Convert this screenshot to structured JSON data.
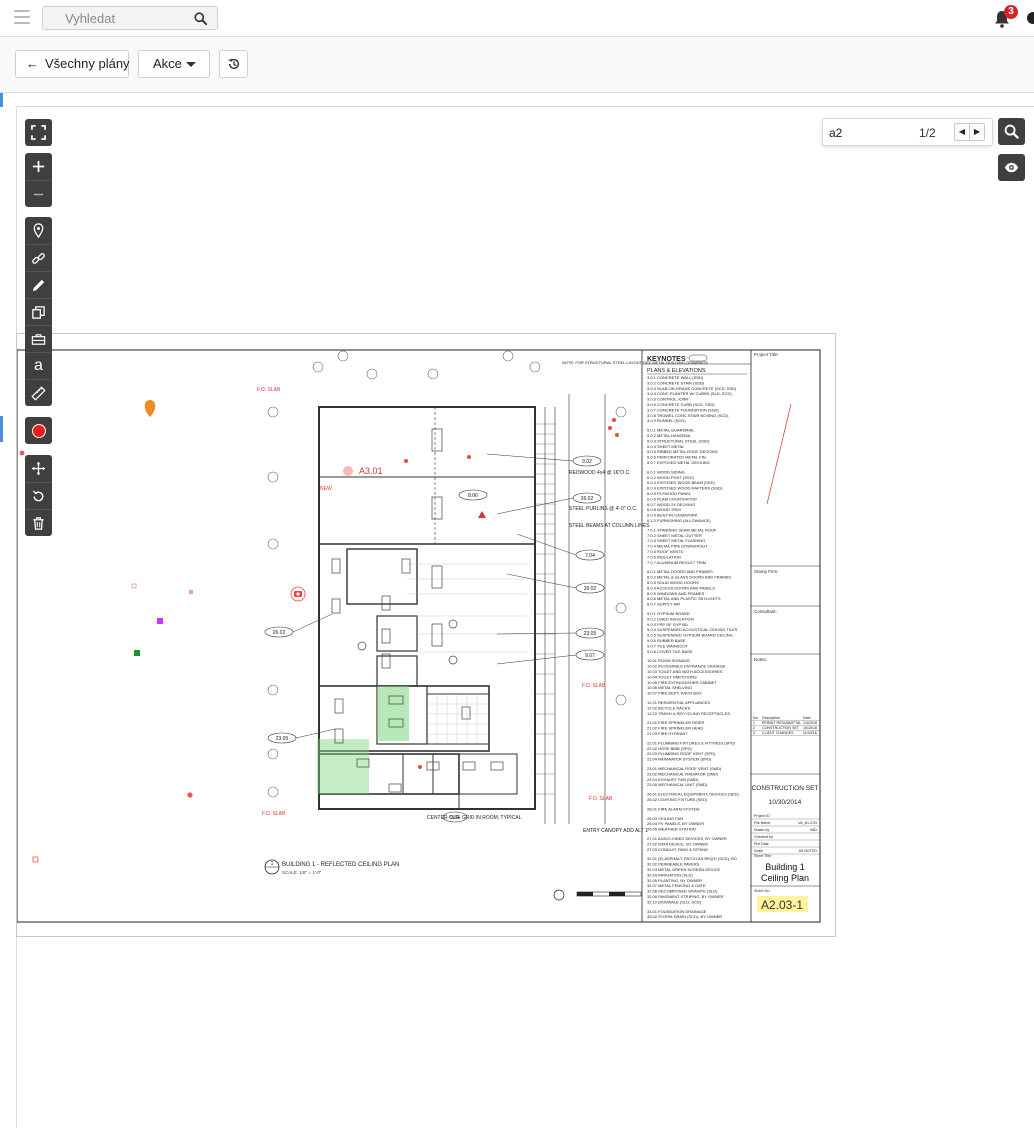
{
  "header": {
    "search": {
      "placeholder": "Vyhledat",
      "value": ""
    },
    "notifications": {
      "count": "3"
    }
  },
  "toolbar": {
    "back_label": "Všechny plány",
    "actions_label": "Akce"
  },
  "find": {
    "query": "a2",
    "count": "1/2"
  },
  "tools": {
    "text_glyph": "a"
  },
  "drawing": {
    "keynotes_title": "KEYNOTES",
    "section_title": "PLANS & ELEVATIONS",
    "project_title_label": "Project Title:",
    "stamp_label": "Stamp Firm:",
    "consultant_label": "Consultant:",
    "notes_label": "Notes:",
    "set_title": "CONSTRUCTION SET",
    "set_date": "10/30/2014",
    "sheet_title_line1": "Building 1",
    "sheet_title_line2": "Ceiling Plan",
    "sheet_number": "A2.03-1",
    "plan_caption": "BUILDING 1 - REFLECTED CEILING PLAN",
    "plan_scale": "SCALE: 1/8\" = 1'-0\"",
    "callout": "A3.01",
    "callout_sub": "NEW",
    "note_text": "NOTE: FOR STRUCTURAL STEEL LAYOUT SEE METAL BUILDING DRAWINGS",
    "labels": {
      "redwood": "REDWOOD 4x4 @ 16\"O.C.",
      "purlins": "STEEL PURLINS @ 4'-0\" O.C.",
      "beams": "STEEL BEAMS AT COLUMN LINES",
      "center": "CENTER CLG. GRID IN ROOM, TYPICAL",
      "entry": "ENTRY CANOPY ADD ALT 1",
      "typ": "TYP",
      "fo_slab": "F.O. SLAB"
    },
    "tags": [
      "9.02",
      "8.06",
      "26.02",
      "7.04",
      "26.02",
      "23.05",
      "9.07",
      "26.02",
      "23.05",
      "9.04"
    ],
    "keynotes": [
      "3.0.1 CONCRETE WALL (SSD)",
      "3.0.2 CONCRETE STAIR (SSD)",
      "3.0.3 SLAB-ON-GRADE CONCRETE (SCD, SSD)",
      "3.0.4 CONC PLANTER W/ CURBS (SLD, SCD)",
      "3.0.5 CONTROL JOINT",
      "3.0.6 CONCRETE CURB (SCD, SSD)",
      "3.0.7 CONCRETE FOUNDATION (SSD)",
      "3.0.8 TROWEL CONC STAIR NOSING (SCD)",
      "3.0.9 RUNNEL (SCD)",
      "5.0.1 METAL GUARDRAIL",
      "5.0.2 METAL HANDRAIL",
      "5.0.3 STRUCTURAL STEEL (SSD)",
      "5.0.4 SHEET METAL",
      "5.0.5 RIBBED METAL ROOF DECKING",
      "5.0.6 PERFORATED METAL FIN",
      "5.0.7 EXPOSED METAL DECKING",
      "6.0.1 WOOD SIDING",
      "6.0.2 WOOD POST (SSD)",
      "6.0.3 EXPOSED WOOD BEAM (SSD)",
      "6.0.4 EXPOSED WOOD RAFTERS (SSD)",
      "6.0.5 PLYWOOD PANEL",
      "6.0.6 PLAM COUNTERTOP",
      "6.0.7 WOOD 2X DECKING",
      "6.0.8 WOOD TRIM",
      "6.0.9 BUILT-IN CASEWORK",
      "6.1.0 FURNISHING (ALLOWANCE)",
      "7.0.1 STANDING SEAM METAL ROOF",
      "7.0.2 SHEET METAL GUTTER",
      "7.0.3 SHEET METAL FLASHING",
      "7.0.4 METAL PIPE DOWNSPOUT",
      "7.0.5 ROOF VENTS",
      "7.0.6 INSULATION",
      "7.0.7 ALUMINUM REGLET TRIM",
      "8.0.1 METAL DOORS AND FRAMES",
      "8.0.2 METAL & GLASS DOORS AND FRAMES",
      "8.0.3 SOLID WOOD DOORS",
      "8.0.4 ACCESS DOORS AND PANELS",
      "8.0.5 WINDOWS AND FRAMES",
      "8.0.6 METAL AND PLASTIC SKYLIGHTS",
      "8.0.7 SUPPLY AIR",
      "9.0.1 GYPSUM BOARD",
      "9.0.2 LINED INSULATION",
      "9.0.3 FRP OF GYP BD",
      "9.0.4 SUSPENDED ACOUSTICAL CEILING TILES",
      "9.0.5 SUSPENDED GYPSUM BOARD CEILING",
      "9.0.6 RUBBER BASE",
      "9.0.7 TILE WAINSCOT",
      "9.0.8 COVED TILE BASE",
      "10.01 ROOM SIGNAGE",
      "10.02 ACCESSIBLE ENTRANCE SIGNAGE",
      "10.03 TOILET AND BATH ACCESSORIES",
      "10.04 TOILET PARTITIONS",
      "10.05 FIRE EXTINGUISHER CABINET",
      "10.06 METAL SHELVING",
      "10.07 FIRE DEPT. KNOX BOX",
      "12.01 RESIDENTIAL APPLIANCES",
      "12.02 BICYCLE RACKS",
      "12.03 TRASH & RECYCLING RECEPTACLES",
      "21.01 FIRE SPRINKLER RISER",
      "21.02 FIRE SPRINKLER HEAD",
      "21.03 FIRE HYDRANT",
      "22.01 PLUMBING FIXTURES & FITTINGS (SPD)",
      "22.02 HOSE BIBB (SPD)",
      "22.03 PLUMBING ROOF VENT (SPD)",
      "22.04 RAINWATER SYSTEM (SPD)",
      "23.01 MECHANICAL ROOF VENT (SMD)",
      "23.02 MECHANICAL RADIATOR (SMD)",
      "23.04 EXHAUST FAN (SMD)",
      "23.05 MECHANICAL UNIT (SMD)",
      "26.01 ELECTRICAL EQUIPMENT, DEVICES (SED)",
      "26.02 LIGHTING FIXTURE (SED)",
      "28.01 FIRE ALARM SYSTEM",
      "26.03 CEILING FAN",
      "26.04 PV PANELS, BY OWNER",
      "26.05 WEATHER STATION",
      "27.01 AUDIO-VIDEO DEVICES, BY OWNER",
      "27.02 DATA DEVICE, BY OWNER",
      "27.03 CONDUIT, RING & STRING",
      "32.01 (E) ASPHALT, PATCH AS REQ'D (SCD), BO",
      "32.02 PERMEABLE PAVERS",
      "32.03 METAL GREEN SCREEN DEVICE",
      "32.04 IRRIGATION (SLD)",
      "32.05 PLANTING, BY OWNER",
      "32.07 METAL FENCING & GATE",
      "32.08 DECOMPOSED GRANITE (SLD)",
      "32.09 PAVEMENT STRIPING, BY OWNER",
      "32.10 BIOSWALE (SLD, SCD)",
      "33.01 FOUNDATION DRAINAGE",
      "33.02 STORM DRAIN (SCD), BY OWNER"
    ],
    "revisions": {
      "headers": [
        "No.",
        "Description",
        "Date"
      ],
      "rows": [
        [
          "1",
          "PERMIT RESUBMITTAL",
          "1/4/2016"
        ],
        [
          "2",
          "CONSTRUCTION SET",
          "10/30/16"
        ],
        [
          "3",
          "CLIENT CHANGES",
          "11/03/16"
        ]
      ]
    },
    "info": [
      [
        "Project ID",
        ""
      ],
      [
        "File Name",
        "VA_A1.2.03"
      ],
      [
        "Drawn by",
        "VAD"
      ],
      [
        "Checked by",
        ""
      ],
      [
        "Plot Date",
        ""
      ],
      [
        "Scale",
        "AS NOTED"
      ]
    ],
    "sheet_title_label": "Sheet Title:",
    "sheet_no_label": "Sheet No.:"
  },
  "colors": {
    "accent_dark": "#3f3f3f",
    "badge": "#d8222a",
    "highlight_green": "#7cd67c",
    "sheet_highlight": "#fff59d"
  }
}
